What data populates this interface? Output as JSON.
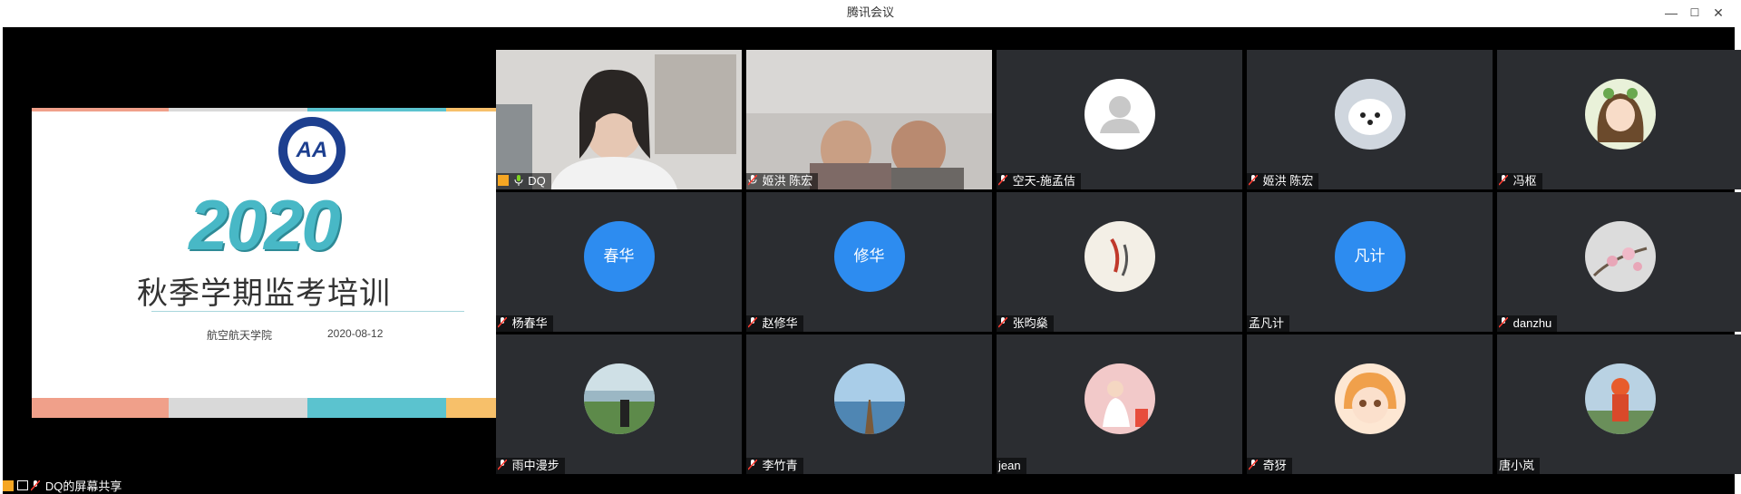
{
  "window": {
    "title": "腾讯会议",
    "minimize": "—",
    "maximize": "☐",
    "close": "✕"
  },
  "slide": {
    "year": "2020",
    "title": "秋季学期监考培训",
    "department": "航空航天学院",
    "date": "2020-08-12",
    "colors": {
      "salmon": "#f0a08a",
      "grey": "#d9d9d9",
      "teal": "#5bc3cf",
      "amber": "#f7c06a"
    }
  },
  "participants": [
    {
      "name": "DQ",
      "kind": "video",
      "host": true
    },
    {
      "name": "姬洪 陈宏",
      "kind": "video"
    },
    {
      "name": "空天-施孟佶",
      "kind": "avatar",
      "icon": "default-user-icon"
    },
    {
      "name": "姬洪 陈宏",
      "kind": "avatar",
      "icon": "white-dog-avatar"
    },
    {
      "name": "冯枢",
      "kind": "avatar",
      "icon": "cartoon-girl-avatar"
    },
    {
      "name": "杨春华",
      "kind": "text",
      "initials": "春华"
    },
    {
      "name": "赵修华",
      "kind": "text",
      "initials": "修华"
    },
    {
      "name": "张昀燊",
      "kind": "avatar",
      "icon": "koi-fish-avatar"
    },
    {
      "name": "孟凡计",
      "kind": "text",
      "initials": "凡计"
    },
    {
      "name": "danzhu",
      "kind": "avatar",
      "icon": "blossom-avatar"
    },
    {
      "name": "雨中漫步",
      "kind": "avatar",
      "icon": "lakeside-avatar"
    },
    {
      "name": "李竹青",
      "kind": "avatar",
      "icon": "pier-avatar"
    },
    {
      "name": "jean",
      "kind": "avatar",
      "icon": "girl-photo-avatar"
    },
    {
      "name": "奇犽",
      "kind": "avatar",
      "icon": "anime-girl-avatar"
    },
    {
      "name": "唐小岚",
      "kind": "avatar",
      "icon": "tiger-mascot-avatar"
    }
  ],
  "share_status": "DQ的屏幕共享"
}
